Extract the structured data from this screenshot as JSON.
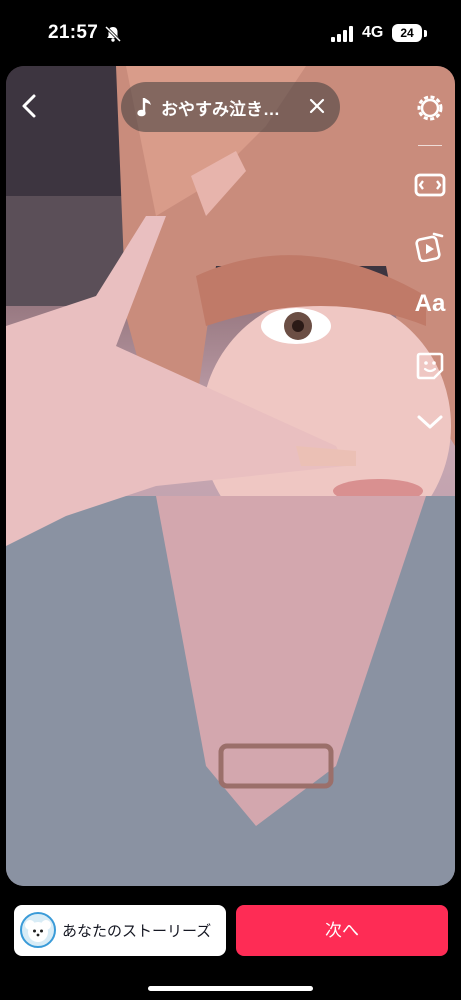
{
  "status_bar": {
    "time": "21:57",
    "network": "4G",
    "battery": "24"
  },
  "music": {
    "title": "おやすみ泣き…"
  },
  "side_tools": {
    "text_tool_label": "Aa"
  },
  "bottom": {
    "story_label": "あなたのストーリーズ",
    "next_label": "次へ"
  },
  "colors": {
    "primary": "#fe2c55"
  }
}
